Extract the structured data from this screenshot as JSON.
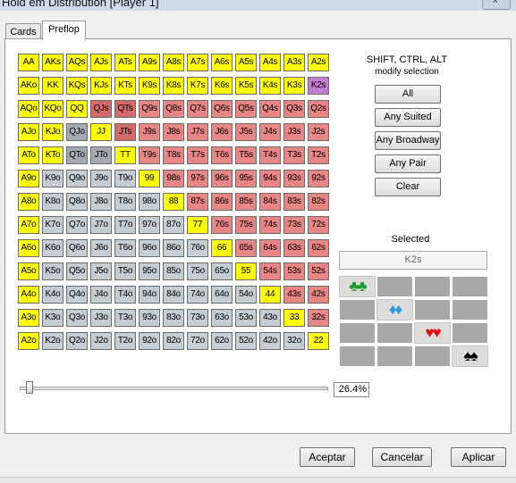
{
  "window": {
    "title": "Hold em Distribution [Player 1]",
    "close_label": "x"
  },
  "tabs": [
    {
      "label": "Cards"
    },
    {
      "label": "Preflop"
    }
  ],
  "grid": {
    "rows": [
      [
        "AA",
        "AKs",
        "AQs",
        "AJs",
        "ATs",
        "A9s",
        "A8s",
        "A7s",
        "A6s",
        "A5s",
        "A4s",
        "A3s",
        "A2s"
      ],
      [
        "AKo",
        "KK",
        "KQs",
        "KJs",
        "KTs",
        "K9s",
        "K8s",
        "K7s",
        "K6s",
        "K5s",
        "K4s",
        "K3s",
        "K2s"
      ],
      [
        "AQo",
        "KQo",
        "QQ",
        "QJs",
        "QTs",
        "Q9s",
        "Q8s",
        "Q7s",
        "Q6s",
        "Q5s",
        "Q4s",
        "Q3s",
        "Q2s"
      ],
      [
        "AJo",
        "KJo",
        "QJo",
        "JJ",
        "JTs",
        "J9s",
        "J8s",
        "J7s",
        "J6s",
        "J5s",
        "J4s",
        "J3s",
        "J2s"
      ],
      [
        "ATo",
        "KTo",
        "QTo",
        "JTo",
        "TT",
        "T9s",
        "T8s",
        "T7s",
        "T6s",
        "T5s",
        "T4s",
        "T3s",
        "T2s"
      ],
      [
        "A9o",
        "K9o",
        "Q9o",
        "J9o",
        "T9o",
        "99",
        "98s",
        "97s",
        "96s",
        "95s",
        "94s",
        "93s",
        "92s"
      ],
      [
        "A8o",
        "K8o",
        "Q8o",
        "J8o",
        "T8o",
        "98o",
        "88",
        "87s",
        "86s",
        "85s",
        "84s",
        "83s",
        "82s"
      ],
      [
        "A7o",
        "K7o",
        "Q7o",
        "J7o",
        "T7o",
        "97o",
        "87o",
        "77",
        "76s",
        "75s",
        "74s",
        "73s",
        "72s"
      ],
      [
        "A6o",
        "K6o",
        "Q6o",
        "J6o",
        "T6o",
        "96o",
        "86o",
        "76o",
        "66",
        "65s",
        "64s",
        "63s",
        "62s"
      ],
      [
        "A5o",
        "K5o",
        "Q5o",
        "J5o",
        "T5o",
        "95o",
        "85o",
        "75o",
        "65o",
        "55",
        "54s",
        "53s",
        "52s"
      ],
      [
        "A4o",
        "K4o",
        "Q4o",
        "J4o",
        "T4o",
        "94o",
        "84o",
        "74o",
        "64o",
        "54o",
        "44",
        "43s",
        "42s"
      ],
      [
        "A3o",
        "K3o",
        "Q3o",
        "J3o",
        "T3o",
        "93o",
        "83o",
        "73o",
        "63o",
        "53o",
        "43o",
        "33",
        "32s"
      ],
      [
        "A2o",
        "K2o",
        "Q2o",
        "J2o",
        "T2o",
        "92o",
        "82o",
        "72o",
        "62o",
        "52o",
        "42o",
        "32o",
        "22"
      ]
    ],
    "colors": {
      "yellow": "#ffff00",
      "suited": "#e88585",
      "offsuit": "#c4ccd4",
      "current": "#c47ed0",
      "offsuit_highlight": "#a4aab2",
      "suited_highlight": "#d56a6a"
    }
  },
  "modifier": {
    "line1": "SHIFT, CTRL, ALT",
    "line2": "modify selection"
  },
  "buttons": [
    {
      "label": "All"
    },
    {
      "label": "Any Suited"
    },
    {
      "label": "Any Broadway"
    },
    {
      "label": "Any Pair"
    },
    {
      "label": "Clear"
    }
  ],
  "selected": {
    "label": "Selected",
    "value": "K2s"
  },
  "suit_matrix": {
    "symbols": [
      "♣♣",
      "♦♦",
      "♥♥",
      "♠♠"
    ],
    "suits": [
      "clubs-icon",
      "diamonds-icon",
      "hearts-icon",
      "spades-icon"
    ],
    "colors": [
      "#1c9a2c",
      "#2a9ad8",
      "#e01010",
      "#000000"
    ]
  },
  "slider": {
    "value": 0.264,
    "label": "26.4%"
  },
  "footer": {
    "accept": "Aceptar",
    "cancel": "Cancelar",
    "apply": "Aplicar"
  }
}
